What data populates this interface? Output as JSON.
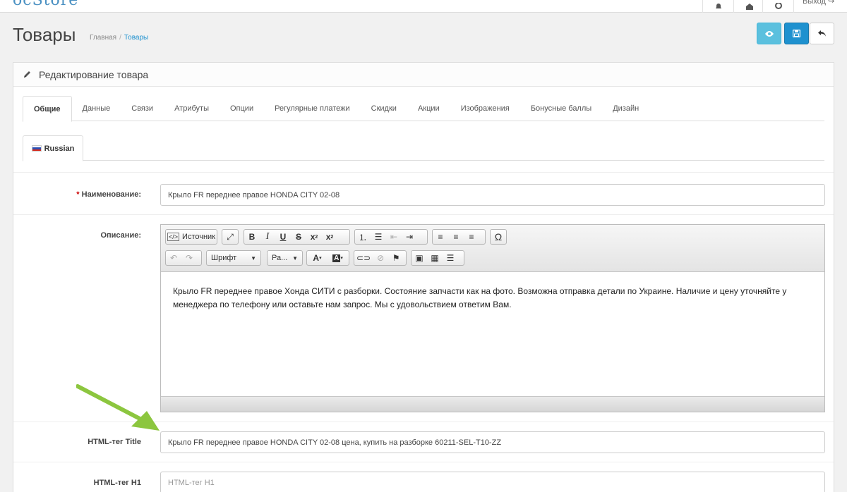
{
  "header": {
    "logo_text": "ocStore",
    "logout_label": "Выход"
  },
  "page": {
    "title": "Товары",
    "breadcrumb": [
      {
        "label": "Главная"
      },
      {
        "label": "Товары"
      }
    ]
  },
  "actions": {
    "view_icon": "eye-icon",
    "save_icon": "save-icon",
    "back_icon": "undo-icon"
  },
  "panel": {
    "title": "Редактирование товара"
  },
  "tabs": [
    "Общие",
    "Данные",
    "Связи",
    "Атрибуты",
    "Опции",
    "Регулярные платежи",
    "Скидки",
    "Акции",
    "Изображения",
    "Бонусные баллы",
    "Дизайн"
  ],
  "active_tab": "Общие",
  "language_tab": {
    "label": "Russian"
  },
  "form": {
    "name_required_mark": "*",
    "name_label": "Наименование:",
    "name_value": "Крыло FR переднее правое HONDA CITY 02-08",
    "description_label": "Описание:",
    "description_text": "Крыло FR переднее правое Хонда СИТИ с разборки. Состояние запчасти как на фото. Возможна отправка детали по Украине. Наличие и цену уточняйте у менеджера по телефону или оставьте нам запрос. Мы с удовольствием ответим Вам.",
    "meta_title_label": "HTML-тег Title",
    "meta_title_value": "Крыло FR переднее правое HONDA CITY 02-08 цена, купить на разборке 60211-SEL-T10-ZZ",
    "h1_label": "HTML-тег H1",
    "h1_placeholder": "HTML-тег H1",
    "h1_value": ""
  },
  "editor": {
    "source_label": "Источник",
    "font_label": "Шрифт",
    "size_label": "Ра..."
  },
  "colors": {
    "accent": "#1e91cf",
    "info": "#5bc0de",
    "arrow": "#8cc63f"
  }
}
